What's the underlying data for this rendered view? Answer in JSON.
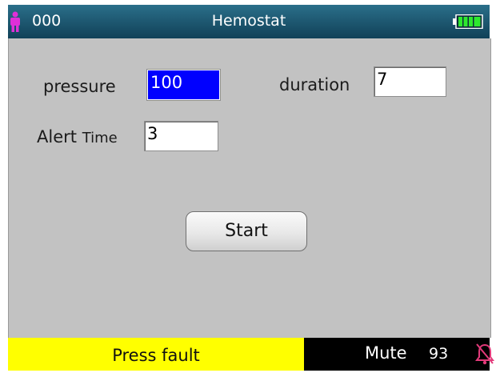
{
  "header": {
    "patient_id": "000",
    "title": "Hemostat",
    "person_icon": "person-icon",
    "battery_icon": "battery-icon",
    "battery_level": 1.0
  },
  "form": {
    "pressure": {
      "label": "pressure",
      "value": "100"
    },
    "duration": {
      "label": "duration",
      "value": "7"
    },
    "alert": {
      "label_a": "Alert",
      "label_b": "Time",
      "value": "3"
    }
  },
  "start_label": "Start",
  "status": {
    "alarm_message": "Press fault",
    "mute_label": "Mute",
    "mute_count": "93",
    "bell_icon": "alarm-off-bell-icon"
  },
  "colors": {
    "header": "#1f5a73",
    "panel": "#c2c2c2",
    "selected_field": "#0000ff",
    "alarm_bg": "#ffff00",
    "person": "#e02fd8",
    "battery": "#2ee82e"
  }
}
